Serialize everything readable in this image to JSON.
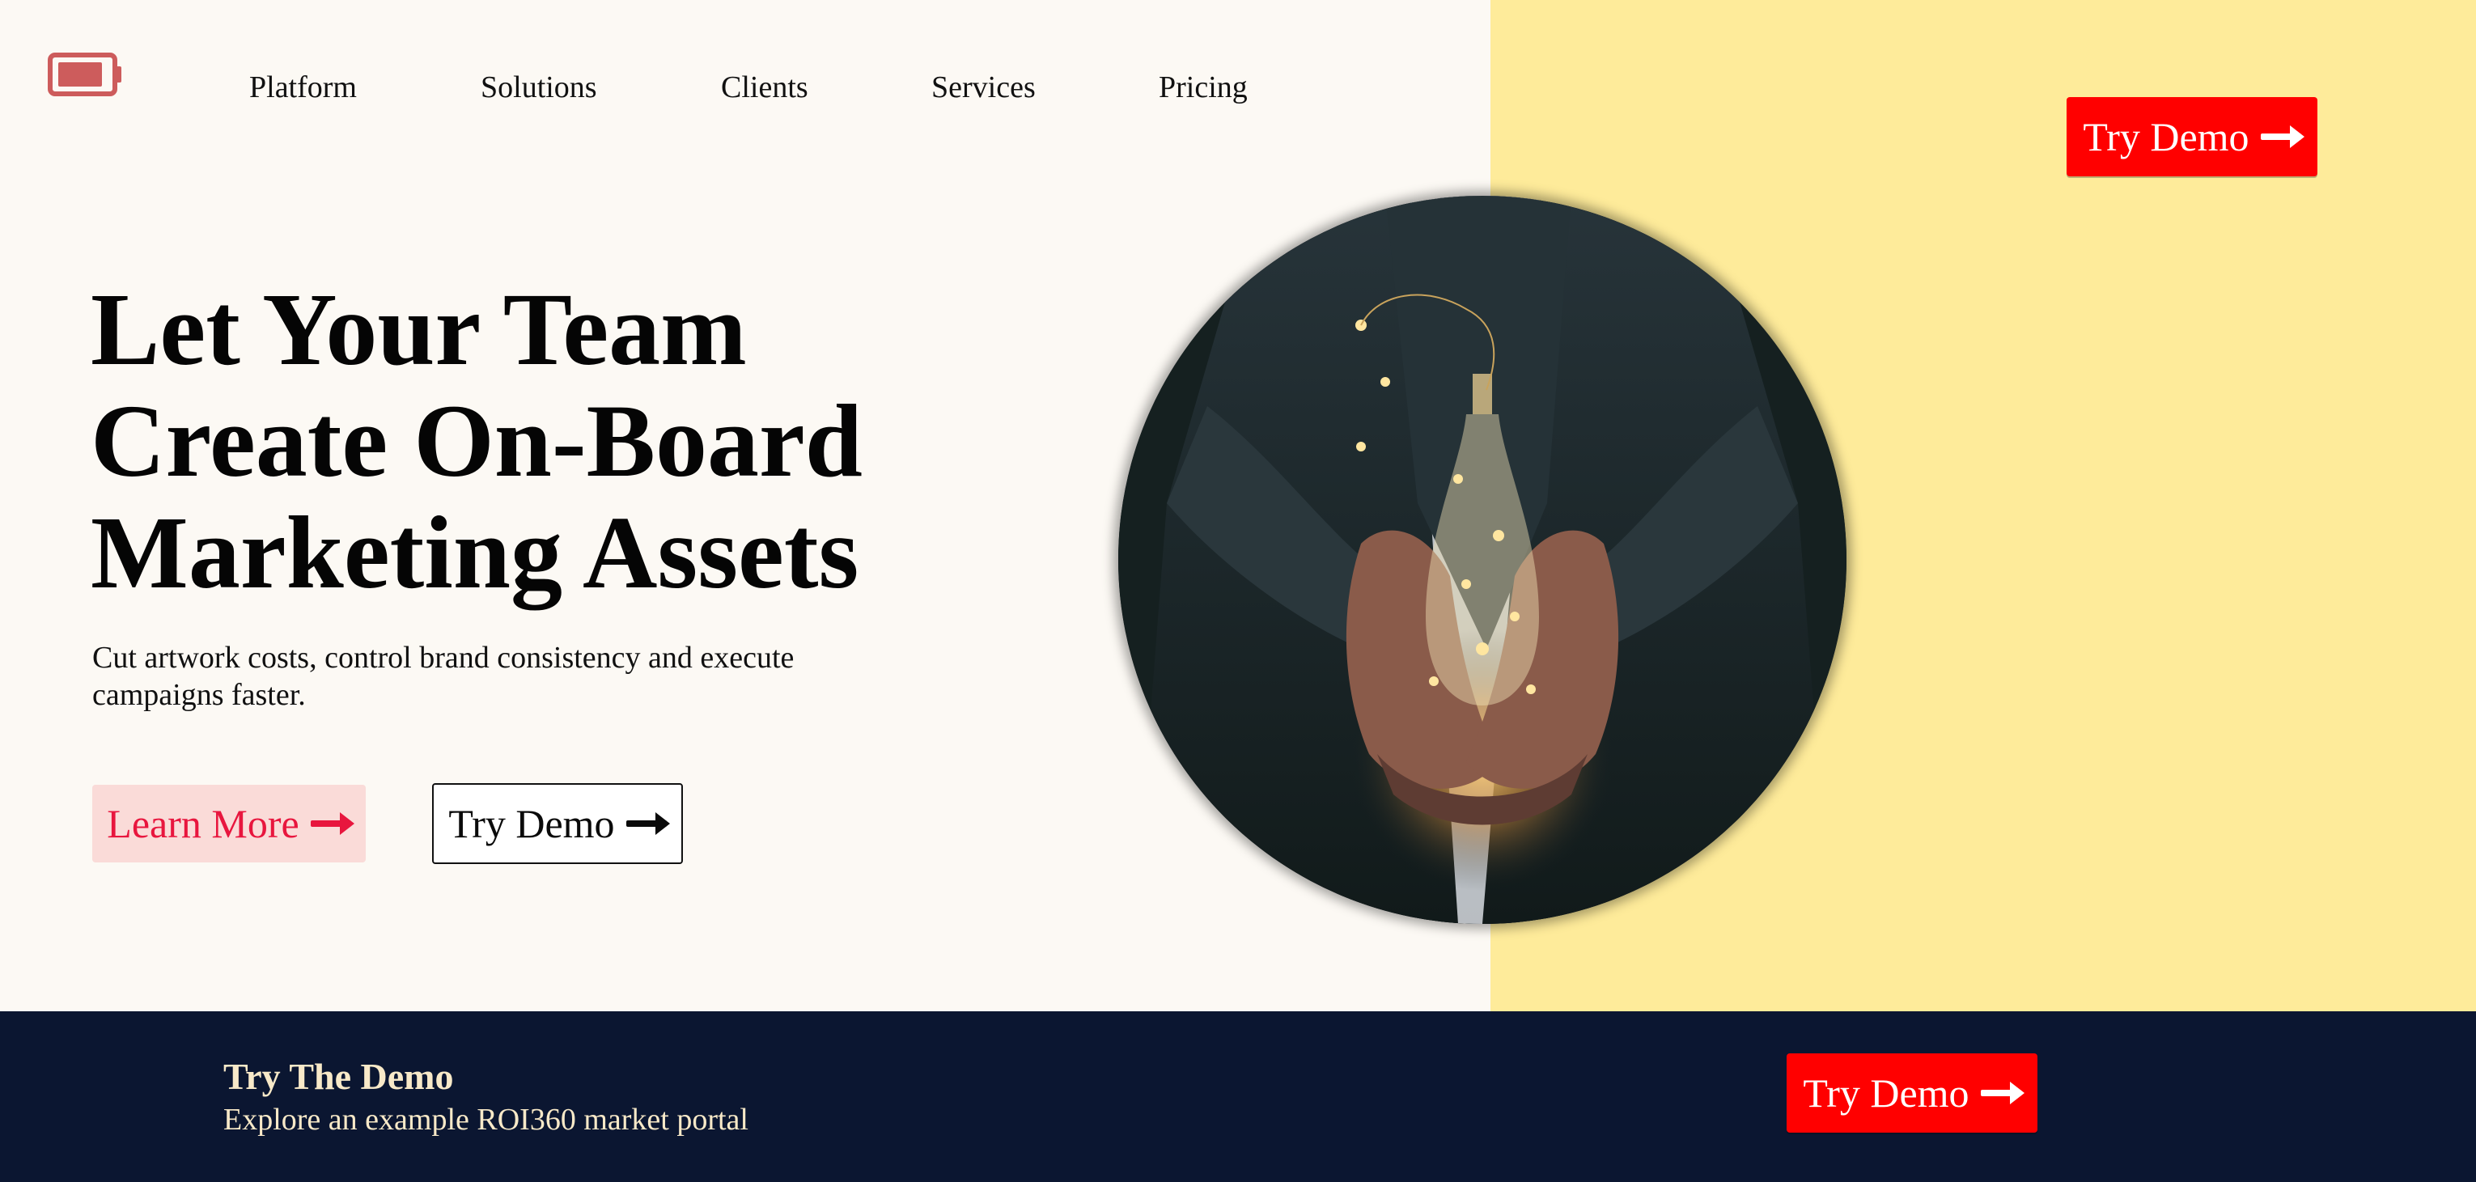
{
  "nav": {
    "logo_icon": "battery-icon",
    "items": [
      {
        "label": "Platform"
      },
      {
        "label": "Solutions"
      },
      {
        "label": "Clients"
      },
      {
        "label": "Services"
      },
      {
        "label": "Pricing"
      }
    ],
    "cta_label": "Try Demo"
  },
  "hero": {
    "headline_lines": [
      "Let Your Team",
      "Create On-Board",
      "Marketing Assets"
    ],
    "subtext": "Cut artwork costs, control brand consistency and execute campaigns faster.",
    "learn_more_label": "Learn More",
    "try_demo_label": "Try Demo",
    "image_icon": "lightbulb-in-hands-photo"
  },
  "demo_bar": {
    "title": "Try The Demo",
    "description": "Explore an example ROI360 market portal",
    "cta_label": "Try Demo"
  },
  "colors": {
    "page_bg": "#fcf9f4",
    "accent_yellow": "#feeb9a",
    "cta_red": "#ff0000",
    "learn_pink_bg": "#fadbd8",
    "learn_pink_text": "#e8163e",
    "footer_navy": "#0b1631",
    "footer_text": "#f8e9c8",
    "logo_red": "#cd5c5c"
  }
}
